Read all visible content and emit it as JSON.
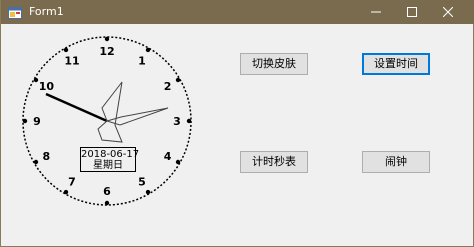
{
  "window": {
    "title": "Form1",
    "controls": {
      "minimize": "minimize-icon",
      "maximize": "maximize-icon",
      "close": "close-icon"
    }
  },
  "clock": {
    "numerals": [
      "12",
      "1",
      "2",
      "3",
      "4",
      "5",
      "6",
      "7",
      "8",
      "9",
      "10",
      "11"
    ],
    "date": "2018-06-17",
    "weekday": "星期日"
  },
  "buttons": {
    "change_skin": "切换皮肤",
    "set_time": "设置时间",
    "stopwatch": "计时秒表",
    "alarm": "闹钟"
  },
  "colors": {
    "titlebar": "#7b6b4e",
    "focus_border": "#0078d7",
    "button_bg": "#e1e1e1"
  }
}
